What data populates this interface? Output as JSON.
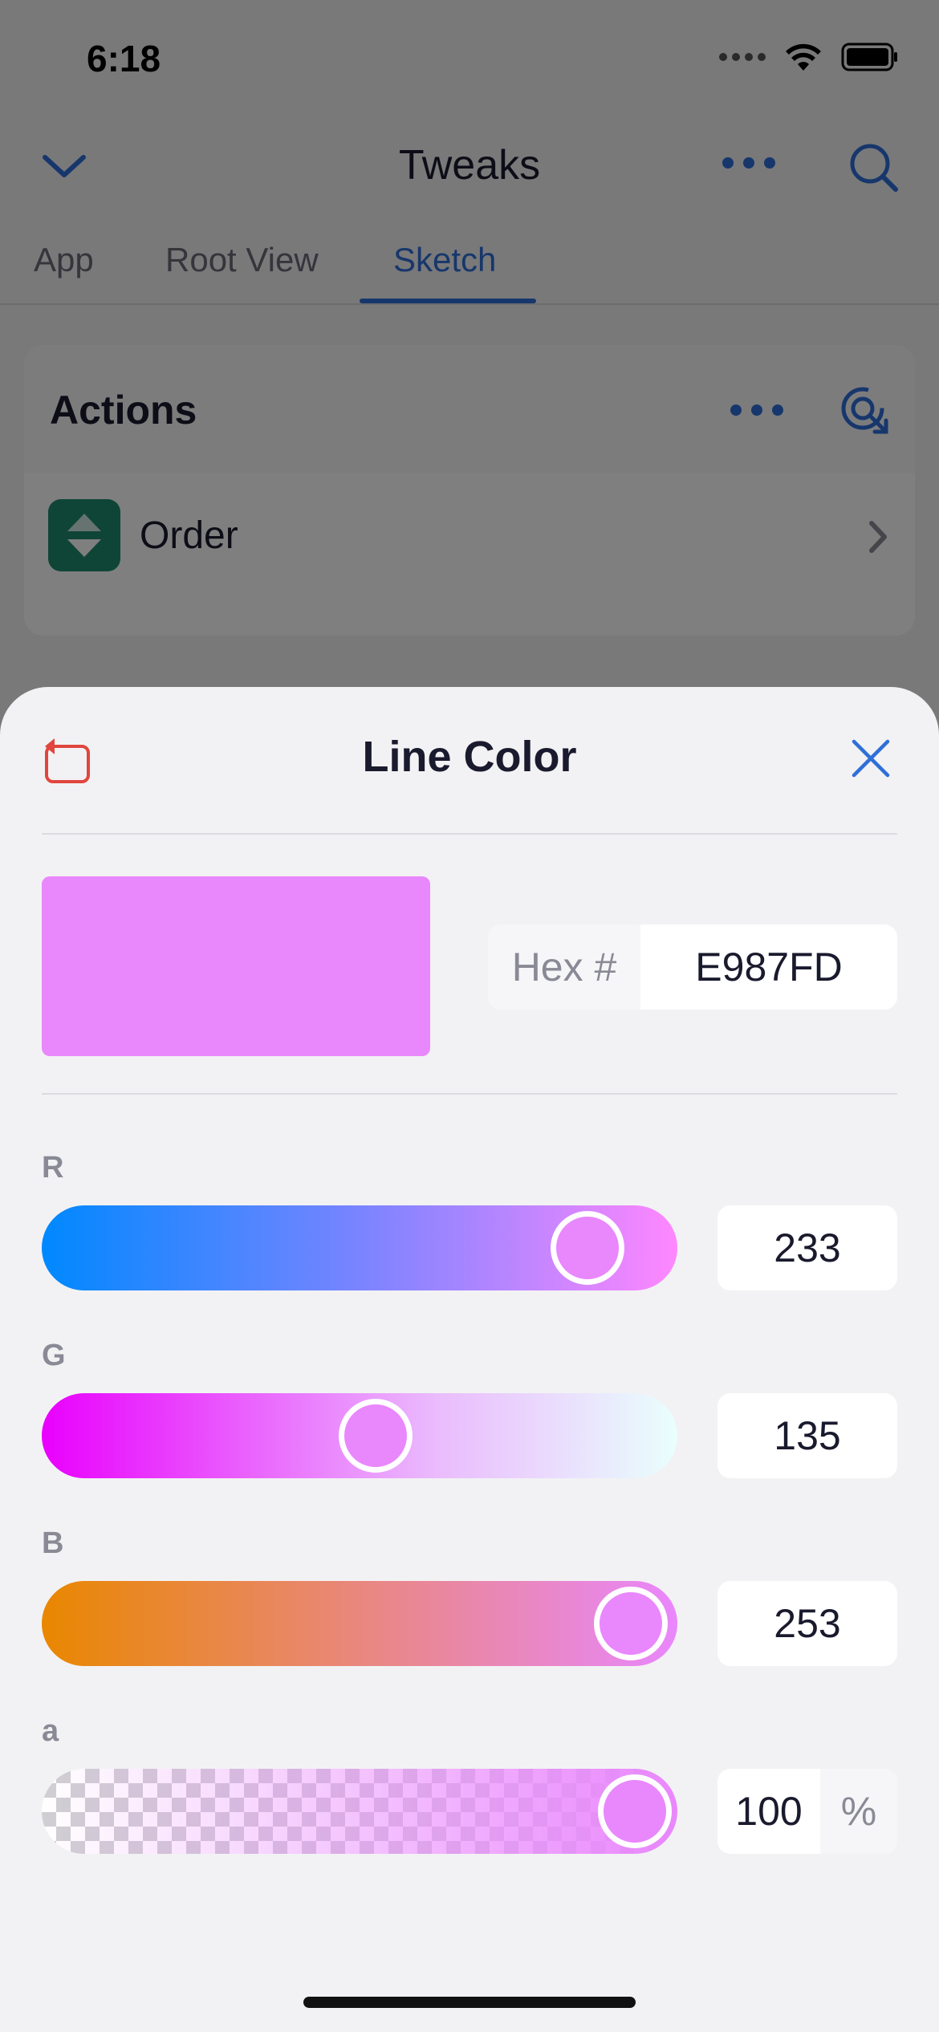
{
  "status_bar": {
    "time": "6:18"
  },
  "nav": {
    "title": "Tweaks"
  },
  "tabs": [
    {
      "label": "App"
    },
    {
      "label": "Root View"
    },
    {
      "label": "Sketch",
      "active": true
    }
  ],
  "actions_card": {
    "title": "Actions",
    "rows": [
      {
        "label": "Order",
        "icon": "sort-icon"
      }
    ]
  },
  "sheet": {
    "title": "Line Color",
    "swatch_color": "#E987FD",
    "hex_label": "Hex #",
    "hex_value": "E987FD",
    "channels": [
      {
        "key": "R",
        "value": "233",
        "level": 0.914
      },
      {
        "key": "G",
        "value": "135",
        "level": 0.529
      },
      {
        "key": "B",
        "value": "253",
        "level": 0.992
      },
      {
        "key": "a",
        "value": "100",
        "unit": "%",
        "level": 1.0
      }
    ]
  },
  "colors": {
    "accent": "#2F6FD8",
    "reset": "#E0463E",
    "row_icon": "#1F8A6E"
  }
}
